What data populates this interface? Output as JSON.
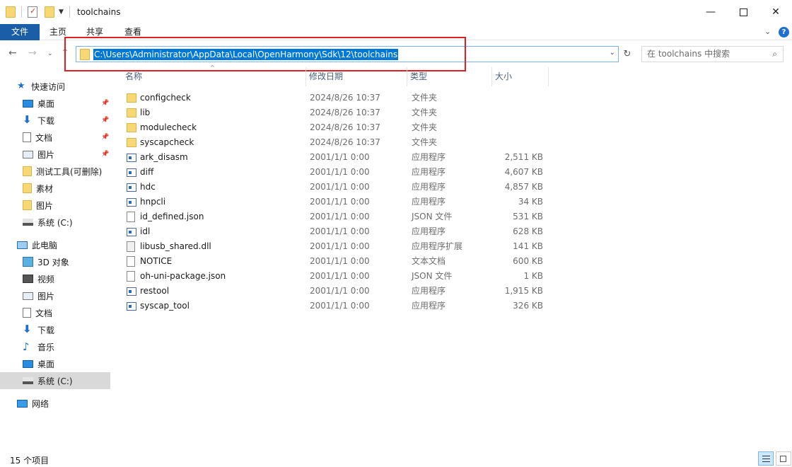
{
  "window": {
    "title": "toolchains",
    "minimize_icon": "minimize-icon",
    "maximize_icon": "maximize-icon",
    "close_icon": "close-icon",
    "minimize_glyph": "—",
    "close_glyph": "✕"
  },
  "ribbon": {
    "tabs": [
      "文件",
      "主页",
      "共享",
      "查看"
    ],
    "expand_glyph": "⌄",
    "help_glyph": "?"
  },
  "nav": {
    "back_glyph": "←",
    "forward_glyph": "→",
    "recent_glyph": "⌄",
    "up_glyph": "↑",
    "address": "C:\\Users\\Administrator\\AppData\\Local\\OpenHarmony\\Sdk\\12\\toolchains",
    "refresh_glyph": "↻",
    "search_placeholder": "在 toolchains 中搜索",
    "search_glyph": "⌕"
  },
  "sidebar": {
    "items": [
      {
        "label": "快速访问",
        "icon": "star-icon",
        "pinned": false
      },
      {
        "label": "桌面",
        "icon": "desktop-icon",
        "pinned": true
      },
      {
        "label": "下载",
        "icon": "download-icon",
        "pinned": true
      },
      {
        "label": "文档",
        "icon": "document-icon",
        "pinned": true
      },
      {
        "label": "图片",
        "icon": "pictures-icon",
        "pinned": true
      },
      {
        "label": "测试工具(可删除)",
        "icon": "folder-icon",
        "pinned": false
      },
      {
        "label": "素材",
        "icon": "folder-icon",
        "pinned": false
      },
      {
        "label": "图片",
        "icon": "folder-icon",
        "pinned": false
      },
      {
        "label": "系统 (C:)",
        "icon": "drive-icon",
        "pinned": false
      },
      {
        "label": "此电脑",
        "icon": "computer-icon",
        "pinned": false
      },
      {
        "label": "3D 对象",
        "icon": "3d-objects-icon",
        "pinned": false
      },
      {
        "label": "视频",
        "icon": "video-icon",
        "pinned": false
      },
      {
        "label": "图片",
        "icon": "pictures-icon",
        "pinned": false
      },
      {
        "label": "文档",
        "icon": "document-icon",
        "pinned": false
      },
      {
        "label": "下载",
        "icon": "download-icon",
        "pinned": false
      },
      {
        "label": "音乐",
        "icon": "music-icon",
        "pinned": false
      },
      {
        "label": "桌面",
        "icon": "desktop-icon",
        "pinned": false
      },
      {
        "label": "系统 (C:)",
        "icon": "drive-icon",
        "pinned": false,
        "selected": true
      },
      {
        "label": "网络",
        "icon": "network-icon",
        "pinned": false
      }
    ],
    "pin_glyph": "📌"
  },
  "columns": {
    "name": "名称",
    "date": "修改日期",
    "type": "类型",
    "size": "大小",
    "sort_glyph": "^"
  },
  "files": [
    {
      "name": "configcheck",
      "date": "2024/8/26 10:37",
      "type": "文件夹",
      "size": "",
      "icon": "folder-icon"
    },
    {
      "name": "lib",
      "date": "2024/8/26 10:37",
      "type": "文件夹",
      "size": "",
      "icon": "folder-icon"
    },
    {
      "name": "modulecheck",
      "date": "2024/8/26 10:37",
      "type": "文件夹",
      "size": "",
      "icon": "folder-icon"
    },
    {
      "name": "syscapcheck",
      "date": "2024/8/26 10:37",
      "type": "文件夹",
      "size": "",
      "icon": "folder-icon"
    },
    {
      "name": "ark_disasm",
      "date": "2001/1/1 0:00",
      "type": "应用程序",
      "size": "2,511 KB",
      "icon": "application-icon"
    },
    {
      "name": "diff",
      "date": "2001/1/1 0:00",
      "type": "应用程序",
      "size": "4,607 KB",
      "icon": "application-icon"
    },
    {
      "name": "hdc",
      "date": "2001/1/1 0:00",
      "type": "应用程序",
      "size": "4,857 KB",
      "icon": "application-icon"
    },
    {
      "name": "hnpcli",
      "date": "2001/1/1 0:00",
      "type": "应用程序",
      "size": "34 KB",
      "icon": "application-icon"
    },
    {
      "name": "id_defined.json",
      "date": "2001/1/1 0:00",
      "type": "JSON 文件",
      "size": "531 KB",
      "icon": "file-icon"
    },
    {
      "name": "idl",
      "date": "2001/1/1 0:00",
      "type": "应用程序",
      "size": "628 KB",
      "icon": "application-icon"
    },
    {
      "name": "libusb_shared.dll",
      "date": "2001/1/1 0:00",
      "type": "应用程序扩展",
      "size": "141 KB",
      "icon": "dll-icon"
    },
    {
      "name": "NOTICE",
      "date": "2001/1/1 0:00",
      "type": "文本文档",
      "size": "600 KB",
      "icon": "file-icon"
    },
    {
      "name": "oh-uni-package.json",
      "date": "2001/1/1 0:00",
      "type": "JSON 文件",
      "size": "1 KB",
      "icon": "file-icon"
    },
    {
      "name": "restool",
      "date": "2001/1/1 0:00",
      "type": "应用程序",
      "size": "1,915 KB",
      "icon": "application-icon"
    },
    {
      "name": "syscap_tool",
      "date": "2001/1/1 0:00",
      "type": "应用程序",
      "size": "326 KB",
      "icon": "application-icon"
    }
  ],
  "status": {
    "count": "15 个项目"
  }
}
